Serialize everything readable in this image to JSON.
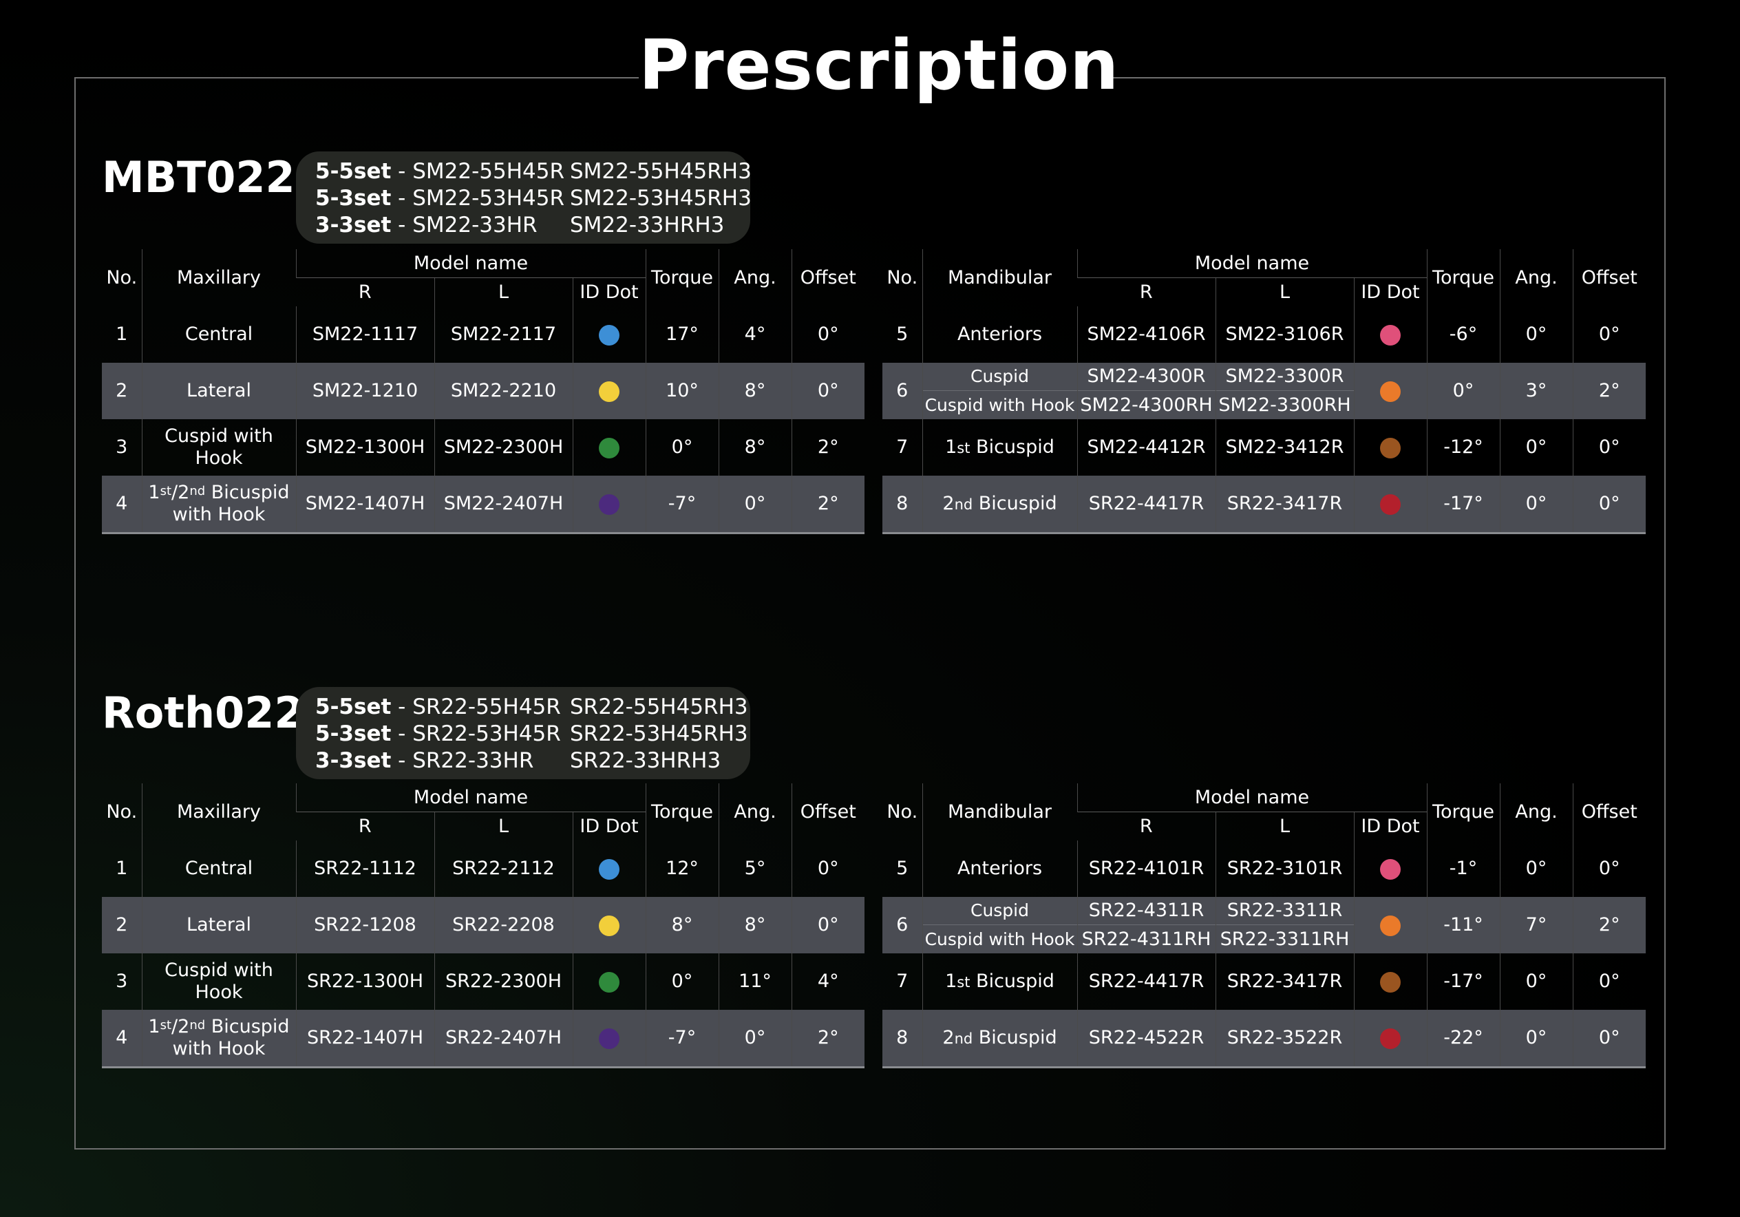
{
  "page_title": "Prescription",
  "sections": [
    {
      "name": "MBT022",
      "sets": [
        {
          "label": "5-5set",
          "sep": " - ",
          "code1": "SM22-55H45R",
          "code2": "SM22-55H45RH3"
        },
        {
          "label": "5-3set",
          "sep": " - ",
          "code1": "SM22-53H45R",
          "code2": "SM22-53H45RH3"
        },
        {
          "label": "3-3set",
          "sep": " - ",
          "code1": "SM22-33HR",
          "code2": "SM22-33HRH3"
        }
      ],
      "maxillary": {
        "headers": {
          "no": "No.",
          "tooth": "Maxillary",
          "model": "Model name",
          "r": "R",
          "l": "L",
          "dot": "ID Dot",
          "torque": "Torque",
          "ang": "Ang.",
          "offset": "Offset"
        },
        "rows": [
          {
            "no": "1",
            "tooth": "Central",
            "r": "SM22-1117",
            "l": "SM22-2117",
            "dot_color": "#3d8fd6",
            "torque": "17°",
            "ang": "4°",
            "offset": "0°"
          },
          {
            "no": "2",
            "tooth": "Lateral",
            "r": "SM22-1210",
            "l": "SM22-2210",
            "dot_color": "#f2cf3b",
            "torque": "10°",
            "ang": "8°",
            "offset": "0°"
          },
          {
            "no": "3",
            "tooth_a": "Cuspid with",
            "tooth_b": "Hook",
            "r": "SM22-1300H",
            "l": "SM22-2300H",
            "dot_color": "#2f8a3c",
            "torque": "0°",
            "ang": "8°",
            "offset": "2°"
          },
          {
            "no": "4",
            "tooth_1": "1",
            "sup_1": "st",
            "slash": "/2",
            "sup_2": "nd",
            "tooth_rest": " Bicuspid",
            "tooth_b": "with Hook",
            "r": "SM22-1407H",
            "l": "SM22-2407H",
            "dot_color": "#4c2a7e",
            "torque": "-7°",
            "ang": "0°",
            "offset": "2°"
          }
        ]
      },
      "mandibular": {
        "headers": {
          "no": "No.",
          "tooth": "Mandibular",
          "model": "Model name",
          "r": "R",
          "l": "L",
          "dot": "ID Dot",
          "torque": "Torque",
          "ang": "Ang.",
          "offset": "Offset"
        },
        "rows": [
          {
            "no": "5",
            "tooth": "Anteriors",
            "r": "SM22-4106R",
            "l": "SM22-3106R",
            "dot_color": "#e0507a",
            "torque": "-6°",
            "ang": "0°",
            "offset": "0°"
          },
          {
            "no": "6",
            "tooth_a": "Cuspid",
            "tooth_b": "Cuspid with Hook",
            "r_a": "SM22-4300R",
            "r_b": "SM22-4300RH",
            "l_a": "SM22-3300R",
            "l_b": "SM22-3300RH",
            "dot_color": "#ea7a2a",
            "torque": "0°",
            "ang": "3°",
            "offset": "2°"
          },
          {
            "no": "7",
            "tooth_1": "1",
            "sup": "st",
            "tooth_rest": " Bicuspid",
            "r": "SM22-4412R",
            "l": "SM22-3412R",
            "dot_color": "#9a5520",
            "torque": "-12°",
            "ang": "0°",
            "offset": "0°"
          },
          {
            "no": "8",
            "tooth_1": "2",
            "sup": "nd",
            "tooth_rest": " Bicuspid",
            "r": "SR22-4417R",
            "l": "SR22-3417R",
            "dot_color": "#b3202c",
            "torque": "-17°",
            "ang": "0°",
            "offset": "0°"
          }
        ]
      }
    },
    {
      "name": "Roth022",
      "sets": [
        {
          "label": "5-5set",
          "sep": " - ",
          "code1": "SR22-55H45R",
          "code2": "SR22-55H45RH3"
        },
        {
          "label": "5-3set",
          "sep": " - ",
          "code1": "SR22-53H45R",
          "code2": "SR22-53H45RH3"
        },
        {
          "label": "3-3set",
          "sep": " - ",
          "code1": "SR22-33HR",
          "code2": "SR22-33HRH3"
        }
      ],
      "maxillary": {
        "headers": {
          "no": "No.",
          "tooth": "Maxillary",
          "model": "Model name",
          "r": "R",
          "l": "L",
          "dot": "ID Dot",
          "torque": "Torque",
          "ang": "Ang.",
          "offset": "Offset"
        },
        "rows": [
          {
            "no": "1",
            "tooth": "Central",
            "r": "SR22-1112",
            "l": "SR22-2112",
            "dot_color": "#3d8fd6",
            "torque": "12°",
            "ang": "5°",
            "offset": "0°"
          },
          {
            "no": "2",
            "tooth": "Lateral",
            "r": "SR22-1208",
            "l": "SR22-2208",
            "dot_color": "#f2cf3b",
            "torque": "8°",
            "ang": "8°",
            "offset": "0°"
          },
          {
            "no": "3",
            "tooth_a": "Cuspid with",
            "tooth_b": "Hook",
            "r": "SR22-1300H",
            "l": "SR22-2300H",
            "dot_color": "#2f8a3c",
            "torque": "0°",
            "ang": "11°",
            "offset": "4°"
          },
          {
            "no": "4",
            "tooth_1": "1",
            "sup_1": "st",
            "slash": "/2",
            "sup_2": "nd",
            "tooth_rest": " Bicuspid",
            "tooth_b": "with Hook",
            "r": "SR22-1407H",
            "l": "SR22-2407H",
            "dot_color": "#4c2a7e",
            "torque": "-7°",
            "ang": "0°",
            "offset": "2°"
          }
        ]
      },
      "mandibular": {
        "headers": {
          "no": "No.",
          "tooth": "Mandibular",
          "model": "Model name",
          "r": "R",
          "l": "L",
          "dot": "ID Dot",
          "torque": "Torque",
          "ang": "Ang.",
          "offset": "Offset"
        },
        "rows": [
          {
            "no": "5",
            "tooth": "Anteriors",
            "r": "SR22-4101R",
            "l": "SR22-3101R",
            "dot_color": "#e0507a",
            "torque": "-1°",
            "ang": "0°",
            "offset": "0°"
          },
          {
            "no": "6",
            "tooth_a": "Cuspid",
            "tooth_b": "Cuspid with Hook",
            "r_a": "SR22-4311R",
            "r_b": "SR22-4311RH",
            "l_a": "SR22-3311R",
            "l_b": "SR22-3311RH",
            "dot_color": "#ea7a2a",
            "torque": "-11°",
            "ang": "7°",
            "offset": "2°"
          },
          {
            "no": "7",
            "tooth_1": "1",
            "sup": "st",
            "tooth_rest": " Bicuspid",
            "r": "SR22-4417R",
            "l": "SR22-3417R",
            "dot_color": "#9a5520",
            "torque": "-17°",
            "ang": "0°",
            "offset": "0°"
          },
          {
            "no": "8",
            "tooth_1": "2",
            "sup": "nd",
            "tooth_rest": " Bicuspid",
            "r": "SR22-4522R",
            "l": "SR22-3522R",
            "dot_color": "#b3202c",
            "torque": "-22°",
            "ang": "0°",
            "offset": "0°"
          }
        ]
      }
    }
  ]
}
